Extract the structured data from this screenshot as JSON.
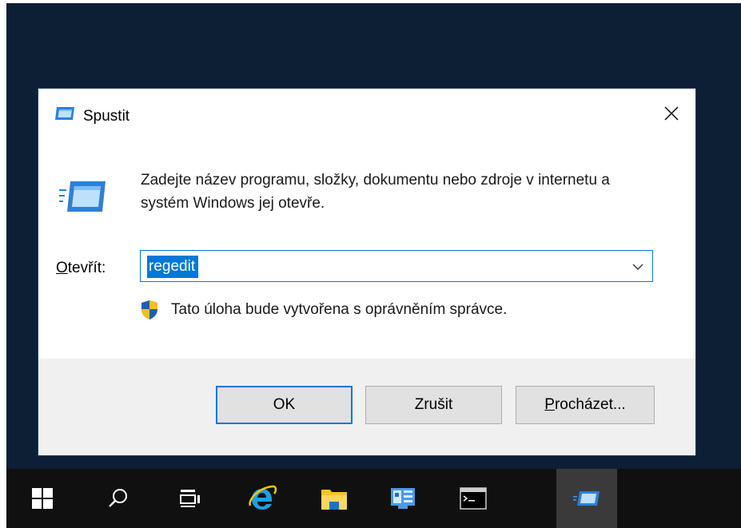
{
  "dialog": {
    "title": "Spustit",
    "title_icon": "run-icon",
    "close_icon": "close-icon",
    "description": "Zadejte název programu, složky, dokumentu nebo zdroje v internetu a systém Windows jej otevře.",
    "open_label_mnemonic": "O",
    "open_label_rest": "tevřít:",
    "input_value": "regedit",
    "admin_note": "Tato úloha bude vytvořena s oprávněním správce.",
    "buttons": {
      "ok": "OK",
      "cancel": "Zrušit",
      "browse_mnemonic": "P",
      "browse_rest": "rocházet..."
    }
  },
  "taskbar": {
    "items": [
      {
        "icon": "windows-start-icon"
      },
      {
        "icon": "search-icon"
      },
      {
        "icon": "task-view-icon"
      },
      {
        "icon": "internet-explorer-icon"
      },
      {
        "icon": "file-explorer-icon"
      },
      {
        "icon": "server-manager-icon"
      },
      {
        "icon": "command-prompt-icon"
      },
      {
        "icon": "run-icon",
        "active": true
      }
    ]
  },
  "colors": {
    "desktop": "#0d1f35",
    "accent": "#0078d7",
    "taskbar": "#101010",
    "footer": "#f0f0f0"
  }
}
